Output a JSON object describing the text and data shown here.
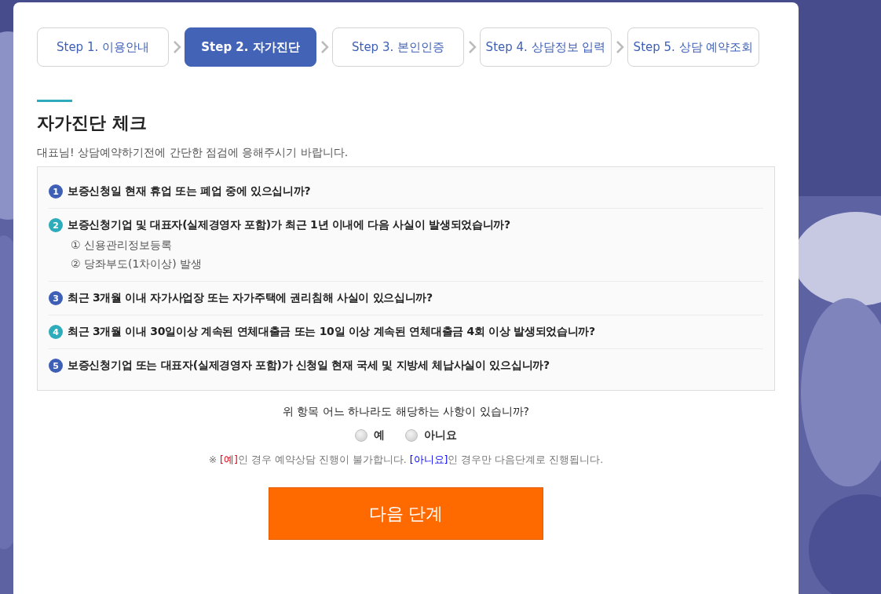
{
  "steps": [
    {
      "label": "Step 1. 이용안내",
      "selected": false
    },
    {
      "label": "Step 2. 자가진단",
      "selected": true
    },
    {
      "label": "Step 3. 본인인증",
      "selected": false
    },
    {
      "label": "Step 4. 상담정보 입력",
      "selected": false
    },
    {
      "label": "Step 5. 상담 예약조회",
      "selected": false
    }
  ],
  "section": {
    "title": "자가진단 체크",
    "intro": "대표님! 상담예약하기전에 간단한 점검에 응해주시기 바랍니다."
  },
  "questions": [
    {
      "number": "1",
      "color": "#3e5fb6",
      "text": "보증신청일 현재 휴업 또는 폐업 중에 있으십니까?"
    },
    {
      "number": "2",
      "color": "#2eacbb",
      "text": "보증신청기업 및 대표자(실제경영자 포함)가 최근 1년 이내에 다음 사실이 발생되었습니까?",
      "sub_items": [
        "① 신용관리정보등록",
        "② 당좌부도(1차이상) 발생"
      ]
    },
    {
      "number": "3",
      "color": "#3e5fb6",
      "text": "최근 3개월 이내 자가사업장 또는 자가주택에 권리침해 사실이 있으십니까?"
    },
    {
      "number": "4",
      "color": "#2eacbb",
      "text": "최근 3개월 이내 30일이상 계속된 연체대출금 또는 10일 이상 계속된 연체대출금 4회 이상 발생되었습니까?"
    },
    {
      "number": "5",
      "color": "#3e5fb6",
      "text": "보증신청기업 또는 대표자(실제경영자 포함)가 신청일 현재 국세 및 지방세 체납사실이 있으십니까?"
    }
  ],
  "prompt": "위 항목 어느 하나라도 해당하는 사항이 있습니까?",
  "options": [
    {
      "label": "예",
      "selected": false
    },
    {
      "label": "아니요",
      "selected": false
    }
  ],
  "note": [
    {
      "text": "※ ",
      "color": "#777777"
    },
    {
      "text": "[예]",
      "color": "#e60012"
    },
    {
      "text": "인 경우 예약상담 진행이 불가합니다. ",
      "color": "#777777"
    },
    {
      "text": "[아니요]",
      "color": "#0000ff"
    },
    {
      "text": "인 경우만 다음단계로 진행됩니다.",
      "color": "#777777"
    }
  ],
  "next_button": "다음 단계"
}
